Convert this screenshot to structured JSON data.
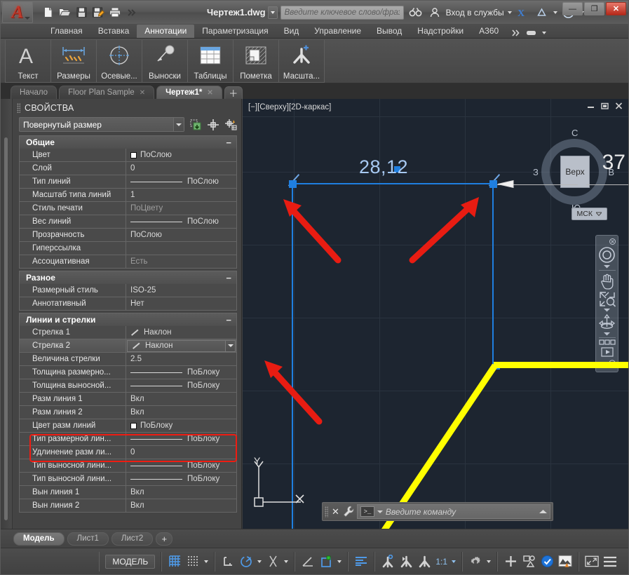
{
  "titlebar": {
    "document_title": "Чертеж1.dwg",
    "search_placeholder": "Введите ключевое слово/фразу",
    "signin_label": "Вход в службы",
    "quick_access": [
      {
        "name": "new-file-icon",
        "label": "Создать"
      },
      {
        "name": "open-file-icon",
        "label": "Открыть"
      },
      {
        "name": "save-icon",
        "label": "Сохранить"
      },
      {
        "name": "save-as-icon",
        "label": "Сохранить как"
      },
      {
        "name": "print-icon",
        "label": "Печать"
      },
      {
        "name": "more-qat-icon",
        "label": "Еще"
      }
    ],
    "window_buttons": {
      "minimize": "—",
      "maximize": "❐",
      "close": "✕"
    }
  },
  "ribbon": {
    "tabs": [
      {
        "label": "Главная",
        "active": false
      },
      {
        "label": "Вставка",
        "active": false
      },
      {
        "label": "Аннотации",
        "active": true
      },
      {
        "label": "Параметризация",
        "active": false
      },
      {
        "label": "Вид",
        "active": false
      },
      {
        "label": "Управление",
        "active": false
      },
      {
        "label": "Вывод",
        "active": false
      },
      {
        "label": "Надстройки",
        "active": false
      },
      {
        "label": "A360",
        "active": false
      }
    ],
    "panels": [
      {
        "label": "Текст",
        "icon": "text-a-icon"
      },
      {
        "label": "Размеры",
        "icon": "dimension-icon"
      },
      {
        "label": "Осевые...",
        "icon": "centerline-icon"
      },
      {
        "label": "Выноски",
        "icon": "leader-icon"
      },
      {
        "label": "Таблицы",
        "icon": "table-icon"
      },
      {
        "label": "Пометка",
        "icon": "markup-icon"
      },
      {
        "label": "Масшта...",
        "icon": "annotation-scale-icon"
      }
    ]
  },
  "file_tabs": [
    {
      "label": "Начало",
      "active": false,
      "closable": false
    },
    {
      "label": "Floor Plan Sample",
      "active": false,
      "closable": true
    },
    {
      "label": "Чертеж1*",
      "active": true,
      "closable": true
    }
  ],
  "properties": {
    "title": "СВОЙСТВА",
    "selected_object": "Повернутый размер",
    "tools": [
      "quick-select-icon",
      "pick-point-icon",
      "select-objects-icon"
    ],
    "groups": [
      {
        "name": "Общие",
        "collapsed_marker": "−",
        "rows": [
          {
            "key": "Цвет",
            "value": "ПоСлою",
            "glyph": "swatch"
          },
          {
            "key": "Слой",
            "value": "0",
            "glyph": "none"
          },
          {
            "key": "Тип линий",
            "value": "ПоСлою",
            "glyph": "line"
          },
          {
            "key": "Масштаб типа линий",
            "value": "1",
            "glyph": "none"
          },
          {
            "key": "Стиль печати",
            "value": "ПоЦвету",
            "glyph": "none",
            "dim": true
          },
          {
            "key": "Вес линий",
            "value": "ПоСлою",
            "glyph": "line"
          },
          {
            "key": "Прозрачность",
            "value": "ПоСлою",
            "glyph": "none"
          },
          {
            "key": "Гиперссылка",
            "value": "",
            "glyph": "none"
          },
          {
            "key": "Ассоциативная",
            "value": "Есть",
            "glyph": "none",
            "dim": true
          }
        ]
      },
      {
        "name": "Разное",
        "collapsed_marker": "−",
        "rows": [
          {
            "key": "Размерный стиль",
            "value": "ISO-25",
            "glyph": "none"
          },
          {
            "key": "Аннотативный",
            "value": "Нет",
            "glyph": "none"
          }
        ]
      },
      {
        "name": "Линии и стрелки",
        "collapsed_marker": "−",
        "rows": [
          {
            "key": "Стрелка 1",
            "value": "Наклон",
            "glyph": "slash",
            "highlight": true
          },
          {
            "key": "Стрелка 2",
            "value": "Наклон",
            "glyph": "slash",
            "highlight": true,
            "editing": true
          },
          {
            "key": "Величина стрелки",
            "value": "2.5",
            "glyph": "none"
          },
          {
            "key": "Толщина  размерно...",
            "value": "ПоБлоку",
            "glyph": "line"
          },
          {
            "key": "Толщина  выносной...",
            "value": "ПоБлоку",
            "glyph": "line"
          },
          {
            "key": "Разм линия 1",
            "value": "Вкл",
            "glyph": "none"
          },
          {
            "key": "Разм линия 2",
            "value": "Вкл",
            "glyph": "none"
          },
          {
            "key": "Цвет разм линий",
            "value": "ПоБлоку",
            "glyph": "swatch"
          },
          {
            "key": "Тип  размерной лин...",
            "value": "ПоБлоку",
            "glyph": "line"
          },
          {
            "key": "Удлинение  разм ли...",
            "value": "0",
            "glyph": "none"
          },
          {
            "key": "Тип выносной лини...",
            "value": "ПоБлоку",
            "glyph": "line"
          },
          {
            "key": "Тип выносной лини...",
            "value": "ПоБлоку",
            "glyph": "line"
          },
          {
            "key": "Вын линия 1",
            "value": "Вкл",
            "glyph": "none"
          },
          {
            "key": "Вын линия 2",
            "value": "Вкл",
            "glyph": "none"
          }
        ]
      }
    ]
  },
  "canvas": {
    "viewport_label": "[−][Сверху][2D-каркас]",
    "viewport_controls": [
      "minimize-icon",
      "restore-icon",
      "close-icon"
    ],
    "dimension_text": "28,12",
    "partial_coordinate": "37",
    "viewcube": {
      "face": "Верх",
      "north": "С",
      "south": "Ю",
      "west": "З",
      "east": "В"
    },
    "ucs_dropdown": "МСК",
    "ucs_axis_y": "Y",
    "navbar_icons": [
      "steering-wheel-icon",
      "pan-hand-icon",
      "zoom-extents-icon",
      "orbit-icon",
      "showmotion-icon"
    ]
  },
  "command_line": {
    "placeholder": "Введите команду",
    "prompt_glyph": ">_",
    "close_label": "✕",
    "customize_icon": "wrench-icon",
    "expand_icon": "chevron-up-icon"
  },
  "layout_tabs": [
    {
      "label": "Модель",
      "active": true
    },
    {
      "label": "Лист1",
      "active": false
    },
    {
      "label": "Лист2",
      "active": false
    }
  ],
  "layout_add_label": "+",
  "status_bar": {
    "model_label": "МОДЕЛЬ",
    "annotation_scale": "1:1",
    "icons": [
      {
        "name": "grid-display-icon",
        "state": "on"
      },
      {
        "name": "snap-mode-icon",
        "state": "off"
      },
      {
        "name": "ortho-mode-icon",
        "state": "off"
      },
      {
        "name": "polar-tracking-icon",
        "state": "on"
      },
      {
        "name": "object-snap-tracking-icon",
        "state": "off"
      },
      {
        "name": "object-snap-icon",
        "state": "off"
      },
      {
        "name": "dynamic-ucs-icon",
        "state": "on"
      },
      {
        "name": "dynamic-input-icon",
        "state": "on"
      },
      {
        "name": "lineweight-icon",
        "state": "on"
      },
      {
        "name": "annotation-visibility-icon",
        "state": "off"
      },
      {
        "name": "annotation-autoscale-icon",
        "state": "off"
      },
      {
        "name": "annotation-scale-list-icon",
        "state": "off"
      },
      {
        "name": "workspace-gear-icon",
        "state": "off"
      },
      {
        "name": "hardware-accel-icon",
        "state": "off"
      },
      {
        "name": "isolate-objects-icon",
        "state": "off"
      },
      {
        "name": "clean-screen-icon",
        "state": "off"
      },
      {
        "name": "customization-menu-icon",
        "state": "off"
      }
    ]
  }
}
